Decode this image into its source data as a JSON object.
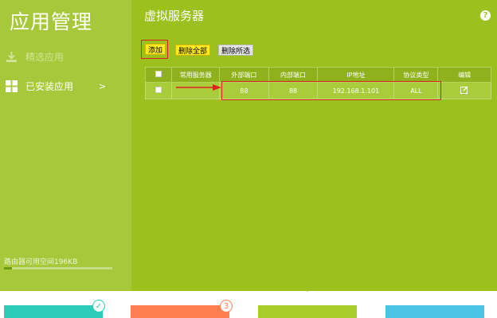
{
  "sidebar": {
    "title": "应用管理",
    "items": [
      {
        "label": "精选应用",
        "icon": "download-icon"
      },
      {
        "label": "已安装应用",
        "icon": "grid-icon",
        "arrow": ">"
      }
    ],
    "storage_text": "路由器可用空间196KB",
    "storage_used_fraction": 0.07
  },
  "main": {
    "title": "虚拟服务器",
    "help": "?",
    "buttons": {
      "add": "添加",
      "delete_all": "删除全部",
      "delete_selected": "删除所选"
    },
    "table": {
      "headers": [
        "",
        "常用服务器",
        "外部端口",
        "内部端口",
        "IP地址",
        "协议类型",
        "编辑"
      ],
      "rows": [
        {
          "server": "",
          "external_port": "88",
          "internal_port": "88",
          "ip": "192.168.1.101",
          "protocol": "ALL"
        }
      ]
    }
  },
  "bottom": {
    "badges": {
      "check": "✓",
      "num": "3"
    },
    "colors": [
      "#2ccab8",
      "#ff7e4e",
      "#a9ce2c",
      "#4cc4e8"
    ]
  }
}
